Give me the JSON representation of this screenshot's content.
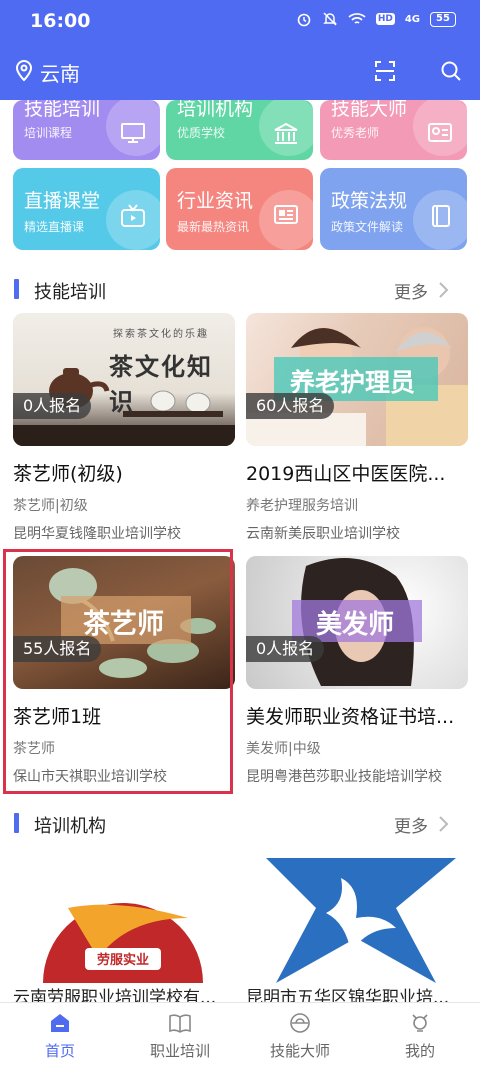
{
  "status": {
    "time": "16:00",
    "hd": "HD",
    "signal": "4G",
    "battery": "55"
  },
  "header": {
    "city": "云南"
  },
  "categories": [
    {
      "title": "技能培训",
      "subtitle": "培训课程",
      "color": "#a38cf0",
      "icon": "monitor-icon"
    },
    {
      "title": "培训机构",
      "subtitle": "优质学校",
      "color": "#5fd6a4",
      "icon": "building-icon"
    },
    {
      "title": "技能大师",
      "subtitle": "优秀老师",
      "color": "#f39ab7",
      "icon": "id-card-icon"
    },
    {
      "title": "直播课堂",
      "subtitle": "精选直播课",
      "color": "#55c9e8",
      "icon": "tv-icon"
    },
    {
      "title": "行业资讯",
      "subtitle": "最新最热资讯",
      "color": "#f4857f",
      "icon": "newspaper-icon"
    },
    {
      "title": "政策法规",
      "subtitle": "政策文件解读",
      "color": "#7fa3ef",
      "icon": "book-icon"
    }
  ],
  "skills_section": {
    "title": "技能培训",
    "more": "更多"
  },
  "courses": [
    {
      "title": "茶艺师(初级)",
      "tag": "茶艺师|初级",
      "school": "昆明华夏钱隆职业培训学校",
      "enroll": "0人报名",
      "overlay_big": "茶文化知识",
      "overlay_small": "探索茶文化的乐趣"
    },
    {
      "title": "2019西山区中医医院...",
      "tag": "养老护理服务培训",
      "school": "云南新美辰职业培训学校",
      "enroll": "60人报名",
      "overlay_big": "养老护理员"
    },
    {
      "title": "茶艺师1班",
      "tag": "茶艺师",
      "school": "保山市天祺职业培训学校",
      "enroll": "55人报名",
      "overlay_big": "茶艺师"
    },
    {
      "title": "美发师职业资格证书培...",
      "tag": "美发师|中级",
      "school": "昆明粤港芭莎职业技能培训学校",
      "enroll": "0人报名",
      "overlay_big": "美发师"
    }
  ],
  "org_section": {
    "title": "培训机构",
    "more": "更多"
  },
  "orgs": [
    {
      "name": "云南劳服职业培训学校有...",
      "logo_text": "劳服实业"
    },
    {
      "name": "昆明市五华区锦华职业培..."
    }
  ],
  "tabs": [
    {
      "label": "首页",
      "icon": "home-icon",
      "active": true
    },
    {
      "label": "职业培训",
      "icon": "open-book-icon"
    },
    {
      "label": "技能大师",
      "icon": "helmet-icon"
    },
    {
      "label": "我的",
      "icon": "user-icon"
    }
  ],
  "colors": {
    "primary": "#4f6bf1",
    "highlight": "#d8334a"
  }
}
